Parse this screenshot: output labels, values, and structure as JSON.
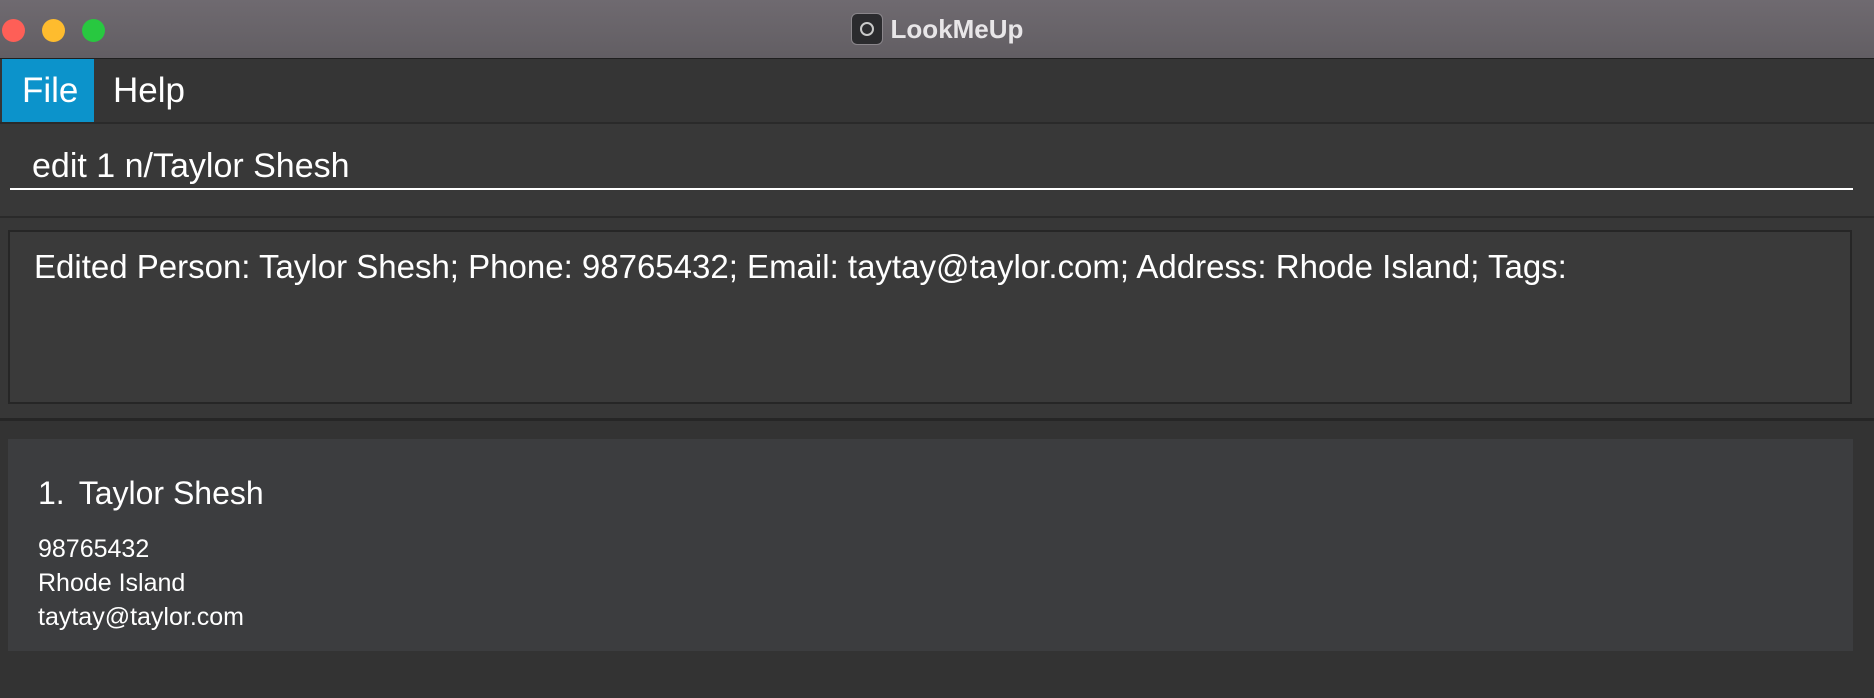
{
  "window": {
    "title": "LookMeUp",
    "app_icon": "camera-icon"
  },
  "menu": {
    "items": [
      {
        "label": "File",
        "active": true
      },
      {
        "label": "Help",
        "active": false
      }
    ]
  },
  "command_box": {
    "value": "edit 1 n/Taylor Shesh"
  },
  "result_display": {
    "text": "Edited Person: Taylor Shesh; Phone: 98765432; Email: taytay@taylor.com; Address: Rhode Island; Tags:"
  },
  "person_list": [
    {
      "index": "1.",
      "name": "Taylor Shesh",
      "phone": "98765432",
      "address": "Rhode Island",
      "email": "taytay@taylor.com"
    }
  ],
  "colors": {
    "menu_active": "#0c93cb",
    "background": "#373737",
    "card": "#3c3d3f"
  }
}
